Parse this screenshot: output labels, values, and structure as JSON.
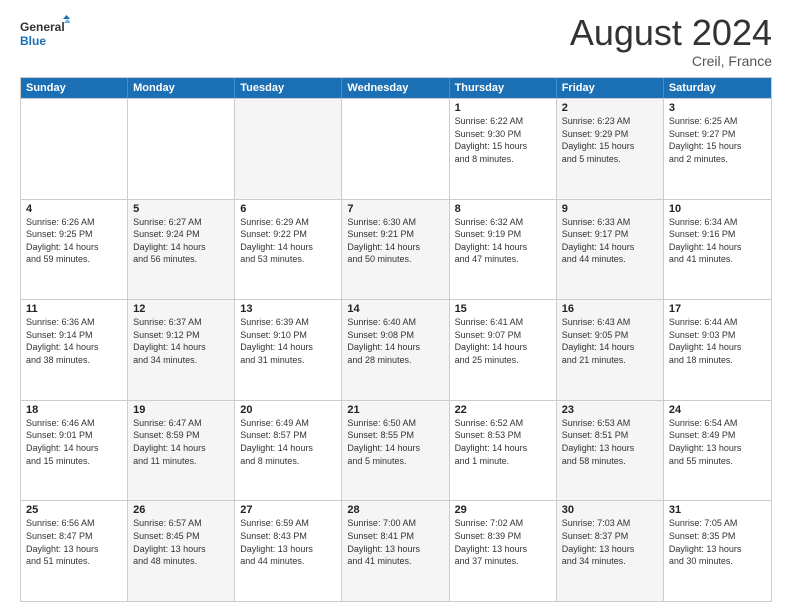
{
  "logo": {
    "line1": "General",
    "line2": "Blue"
  },
  "title": "August 2024",
  "location": "Creil, France",
  "weekdays": [
    "Sunday",
    "Monday",
    "Tuesday",
    "Wednesday",
    "Thursday",
    "Friday",
    "Saturday"
  ],
  "rows": [
    [
      {
        "day": "",
        "info": "",
        "shade": false
      },
      {
        "day": "",
        "info": "",
        "shade": false
      },
      {
        "day": "",
        "info": "",
        "shade": true
      },
      {
        "day": "",
        "info": "",
        "shade": false
      },
      {
        "day": "1",
        "info": "Sunrise: 6:22 AM\nSunset: 9:30 PM\nDaylight: 15 hours\nand 8 minutes.",
        "shade": false
      },
      {
        "day": "2",
        "info": "Sunrise: 6:23 AM\nSunset: 9:29 PM\nDaylight: 15 hours\nand 5 minutes.",
        "shade": true
      },
      {
        "day": "3",
        "info": "Sunrise: 6:25 AM\nSunset: 9:27 PM\nDaylight: 15 hours\nand 2 minutes.",
        "shade": false
      }
    ],
    [
      {
        "day": "4",
        "info": "Sunrise: 6:26 AM\nSunset: 9:25 PM\nDaylight: 14 hours\nand 59 minutes.",
        "shade": false
      },
      {
        "day": "5",
        "info": "Sunrise: 6:27 AM\nSunset: 9:24 PM\nDaylight: 14 hours\nand 56 minutes.",
        "shade": true
      },
      {
        "day": "6",
        "info": "Sunrise: 6:29 AM\nSunset: 9:22 PM\nDaylight: 14 hours\nand 53 minutes.",
        "shade": false
      },
      {
        "day": "7",
        "info": "Sunrise: 6:30 AM\nSunset: 9:21 PM\nDaylight: 14 hours\nand 50 minutes.",
        "shade": true
      },
      {
        "day": "8",
        "info": "Sunrise: 6:32 AM\nSunset: 9:19 PM\nDaylight: 14 hours\nand 47 minutes.",
        "shade": false
      },
      {
        "day": "9",
        "info": "Sunrise: 6:33 AM\nSunset: 9:17 PM\nDaylight: 14 hours\nand 44 minutes.",
        "shade": true
      },
      {
        "day": "10",
        "info": "Sunrise: 6:34 AM\nSunset: 9:16 PM\nDaylight: 14 hours\nand 41 minutes.",
        "shade": false
      }
    ],
    [
      {
        "day": "11",
        "info": "Sunrise: 6:36 AM\nSunset: 9:14 PM\nDaylight: 14 hours\nand 38 minutes.",
        "shade": false
      },
      {
        "day": "12",
        "info": "Sunrise: 6:37 AM\nSunset: 9:12 PM\nDaylight: 14 hours\nand 34 minutes.",
        "shade": true
      },
      {
        "day": "13",
        "info": "Sunrise: 6:39 AM\nSunset: 9:10 PM\nDaylight: 14 hours\nand 31 minutes.",
        "shade": false
      },
      {
        "day": "14",
        "info": "Sunrise: 6:40 AM\nSunset: 9:08 PM\nDaylight: 14 hours\nand 28 minutes.",
        "shade": true
      },
      {
        "day": "15",
        "info": "Sunrise: 6:41 AM\nSunset: 9:07 PM\nDaylight: 14 hours\nand 25 minutes.",
        "shade": false
      },
      {
        "day": "16",
        "info": "Sunrise: 6:43 AM\nSunset: 9:05 PM\nDaylight: 14 hours\nand 21 minutes.",
        "shade": true
      },
      {
        "day": "17",
        "info": "Sunrise: 6:44 AM\nSunset: 9:03 PM\nDaylight: 14 hours\nand 18 minutes.",
        "shade": false
      }
    ],
    [
      {
        "day": "18",
        "info": "Sunrise: 6:46 AM\nSunset: 9:01 PM\nDaylight: 14 hours\nand 15 minutes.",
        "shade": false
      },
      {
        "day": "19",
        "info": "Sunrise: 6:47 AM\nSunset: 8:59 PM\nDaylight: 14 hours\nand 11 minutes.",
        "shade": true
      },
      {
        "day": "20",
        "info": "Sunrise: 6:49 AM\nSunset: 8:57 PM\nDaylight: 14 hours\nand 8 minutes.",
        "shade": false
      },
      {
        "day": "21",
        "info": "Sunrise: 6:50 AM\nSunset: 8:55 PM\nDaylight: 14 hours\nand 5 minutes.",
        "shade": true
      },
      {
        "day": "22",
        "info": "Sunrise: 6:52 AM\nSunset: 8:53 PM\nDaylight: 14 hours\nand 1 minute.",
        "shade": false
      },
      {
        "day": "23",
        "info": "Sunrise: 6:53 AM\nSunset: 8:51 PM\nDaylight: 13 hours\nand 58 minutes.",
        "shade": true
      },
      {
        "day": "24",
        "info": "Sunrise: 6:54 AM\nSunset: 8:49 PM\nDaylight: 13 hours\nand 55 minutes.",
        "shade": false
      }
    ],
    [
      {
        "day": "25",
        "info": "Sunrise: 6:56 AM\nSunset: 8:47 PM\nDaylight: 13 hours\nand 51 minutes.",
        "shade": false
      },
      {
        "day": "26",
        "info": "Sunrise: 6:57 AM\nSunset: 8:45 PM\nDaylight: 13 hours\nand 48 minutes.",
        "shade": true
      },
      {
        "day": "27",
        "info": "Sunrise: 6:59 AM\nSunset: 8:43 PM\nDaylight: 13 hours\nand 44 minutes.",
        "shade": false
      },
      {
        "day": "28",
        "info": "Sunrise: 7:00 AM\nSunset: 8:41 PM\nDaylight: 13 hours\nand 41 minutes.",
        "shade": true
      },
      {
        "day": "29",
        "info": "Sunrise: 7:02 AM\nSunset: 8:39 PM\nDaylight: 13 hours\nand 37 minutes.",
        "shade": false
      },
      {
        "day": "30",
        "info": "Sunrise: 7:03 AM\nSunset: 8:37 PM\nDaylight: 13 hours\nand 34 minutes.",
        "shade": true
      },
      {
        "day": "31",
        "info": "Sunrise: 7:05 AM\nSunset: 8:35 PM\nDaylight: 13 hours\nand 30 minutes.",
        "shade": false
      }
    ]
  ]
}
